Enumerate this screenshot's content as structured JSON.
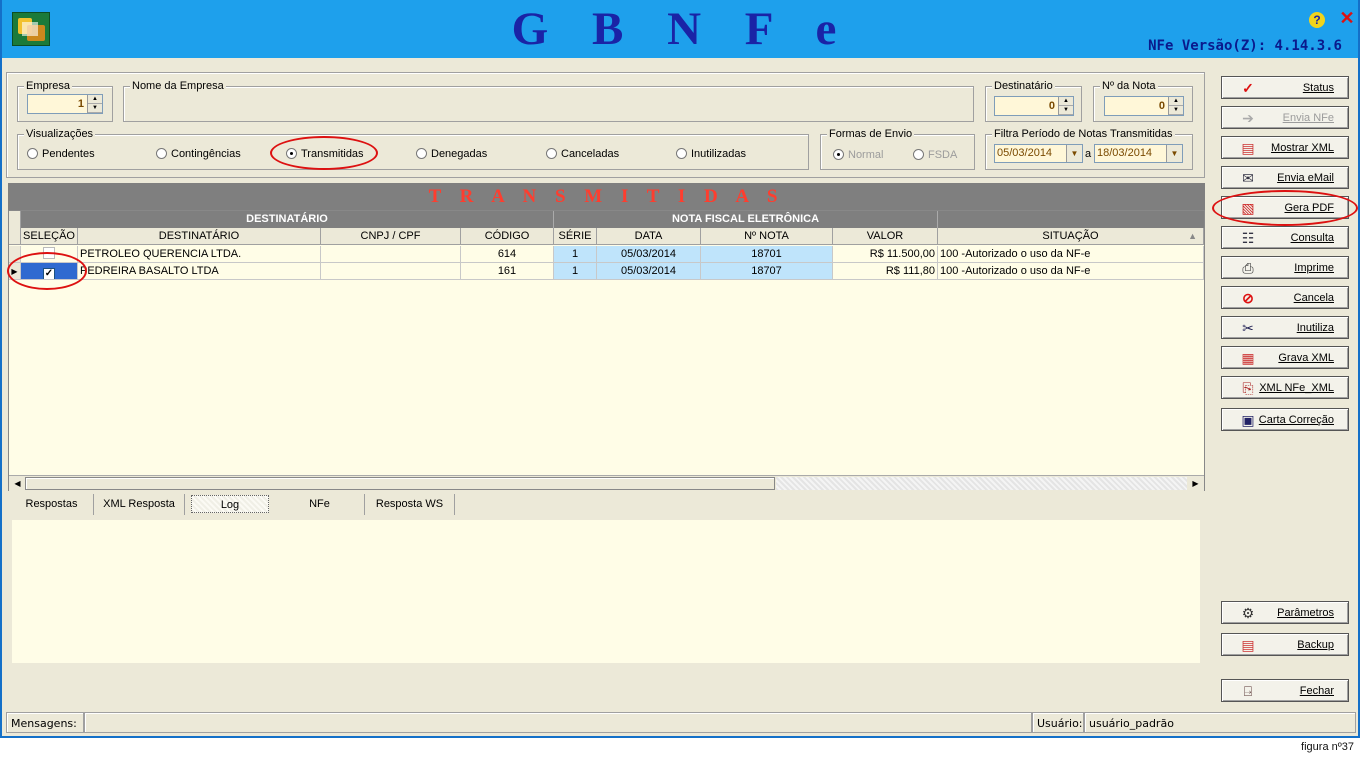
{
  "header": {
    "title": "G B N F e",
    "version": "NFe Versão(Z): 4.14.3.6"
  },
  "empresa": {
    "legend": "Empresa",
    "value": "1"
  },
  "nome_empresa": {
    "legend": "Nome da Empresa",
    "value": ""
  },
  "destinatario": {
    "legend": "Destinatário",
    "value": "0"
  },
  "nr_nota": {
    "legend": "Nº da Nota",
    "value": "0"
  },
  "visualizacoes": {
    "legend": "Visualizações",
    "options": [
      "Pendentes",
      "Contingências",
      "Transmitidas",
      "Denegadas",
      "Canceladas",
      "Inutilizadas"
    ],
    "selected": "Transmitidas"
  },
  "formas_envio": {
    "legend": "Formas de Envio",
    "options": [
      "Normal",
      "FSDA"
    ],
    "selected": "Normal"
  },
  "filtro_periodo": {
    "legend": "Filtra Período de Notas Transmitidas",
    "from": "05/03/2014",
    "sep": "a",
    "to": "18/03/2014"
  },
  "banner": "T R A N S M I T I D A S",
  "grid": {
    "group_headers": [
      "DESTINATÁRIO",
      "NOTA FISCAL ELETRÔNICA"
    ],
    "columns": [
      "SELEÇÃO",
      "DESTINATÁRIO",
      "CNPJ / CPF",
      "CÓDIGO",
      "SÉRIE",
      "DATA",
      "Nº NOTA",
      "VALOR",
      "SITUAÇÃO"
    ],
    "rows": [
      {
        "selected": false,
        "destinatario": "PETROLEO QUERENCIA LTDA.",
        "cnpj": "",
        "codigo": "614",
        "serie": "1",
        "data": "05/03/2014",
        "nota": "18701",
        "valor": "R$ 11.500,00",
        "situacao": "100 -Autorizado o uso da NF-e"
      },
      {
        "selected": true,
        "destinatario": "PEDREIRA BASALTO LTDA",
        "cnpj": "",
        "codigo": "161",
        "serie": "1",
        "data": "05/03/2014",
        "nota": "18707",
        "valor": "R$ 111,80",
        "situacao": "100 -Autorizado o uso da NF-e"
      }
    ]
  },
  "tabs": [
    "Respostas",
    "XML Resposta",
    "Log",
    "NFe",
    "Resposta WS"
  ],
  "active_tab": "Log",
  "buttons": {
    "status": "Status",
    "envia_nfe": "Envia NFe",
    "mostrar_xml": "Mostrar XML",
    "envia_email": "Envia eMail",
    "gera_pdf": "Gera PDF",
    "consulta": "Consulta",
    "imprime": "Imprime",
    "cancela": "Cancela",
    "inutiliza": "Inutiliza",
    "grava_xml": "Grava XML",
    "xml_nfe": "XML NFe_XML",
    "carta_correcao": "Carta Correção",
    "parametros": "Parâmetros",
    "backup": "Backup",
    "fechar": "Fechar"
  },
  "statusbar": {
    "mensagens_label": "Mensagens:",
    "mensagens_value": "",
    "usuario_label": "Usuário:",
    "usuario_value": "usuário_padrão"
  },
  "figure_label": "figura nº37",
  "colors": {
    "header_bg": "#1ea0ec",
    "title": "#1a23a6",
    "banner_text": "#ff3d2e",
    "highlight": "#dd1111"
  }
}
